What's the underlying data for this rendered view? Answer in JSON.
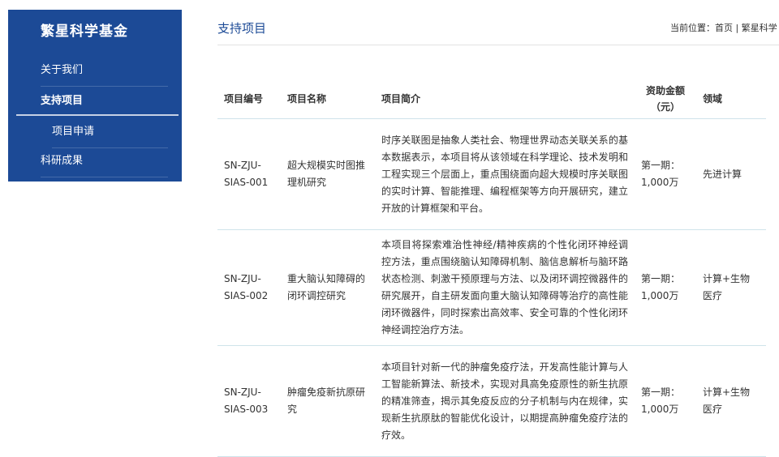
{
  "sidebar": {
    "title": "繁星科学基金",
    "items": [
      {
        "label": "关于我们"
      },
      {
        "label": "支持项目"
      },
      {
        "label": "项目申请"
      },
      {
        "label": "科研成果"
      }
    ]
  },
  "main": {
    "title": "支持项目",
    "breadcrumb": {
      "prefix": "当前位置：",
      "home": "首页",
      "separator": " | ",
      "current": "繁星科学"
    }
  },
  "table": {
    "headers": {
      "code": "项目编号",
      "name": "项目名称",
      "intro": "项目简介",
      "amount": "资助金额（元）",
      "field": "领域"
    },
    "rows": [
      {
        "code": "SN-ZJU-SIAS-001",
        "name": "超大规模实时图推理机研究",
        "intro": "时序关联图是抽象人类社会、物理世界动态关联关系的基本数据表示，本项目将从该领域在科学理论、技术发明和工程实现三个层面上，重点围绕面向超大规模时序关联图的实时计算、智能推理、编程框架等方向开展研究，建立开放的计算框架和平台。",
        "amount": "第一期：1,000万",
        "field": "先进计算"
      },
      {
        "code": "SN-ZJU-SIAS-002",
        "name": "重大脑认知障碍的闭环调控研究",
        "intro": "本项目将探索难治性神经/精神疾病的个性化闭环神经调控方法，重点围绕脑认知障碍机制、脑信息解析与脑环路状态检测、刺激干预原理与方法、以及闭环调控微器件的研究展开，自主研发面向重大脑认知障碍等治疗的高性能闭环微器件，同时探索出高效率、安全可靠的个性化闭环神经调控治疗方法。",
        "amount": "第一期：1,000万",
        "field": "计算+生物医疗"
      },
      {
        "code": "SN-ZJU-SIAS-003",
        "name": "肿瘤免疫新抗原研究",
        "intro": "本项目针对新一代的肿瘤免疫疗法，开发高性能计算与人工智能新算法、新技术，实现对具高免疫原性的新生抗原的精准筛查，揭示其免疫反应的分子机制与内在规律，实现新生抗原肽的智能优化设计，以期提高肿瘤免疫疗法的疗效。",
        "amount": "第一期：1,000万",
        "field": "计算+生物医疗"
      }
    ]
  }
}
